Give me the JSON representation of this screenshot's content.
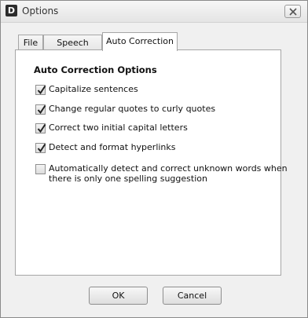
{
  "window": {
    "title": "Options",
    "app_icon_letter": "D"
  },
  "tabs": [
    {
      "label": "File",
      "active": false
    },
    {
      "label": "Speech",
      "active": false
    },
    {
      "label": "Auto Correction",
      "active": true
    }
  ],
  "panel": {
    "section_title": "Auto Correction Options",
    "options": [
      {
        "label": "Capitalize sentences",
        "checked": true
      },
      {
        "label": "Change regular quotes to curly quotes",
        "checked": true
      },
      {
        "label": "Correct two initial capital letters",
        "checked": true
      },
      {
        "label": "Detect and format hyperlinks",
        "checked": true
      },
      {
        "label_line1": "Automatically detect and correct unknown words when",
        "label_line2": "there is only one spelling suggestion",
        "checked": false
      }
    ]
  },
  "buttons": {
    "ok": "OK",
    "cancel": "Cancel"
  },
  "icons": {
    "close": "close-icon",
    "check": "checkmark-icon"
  }
}
